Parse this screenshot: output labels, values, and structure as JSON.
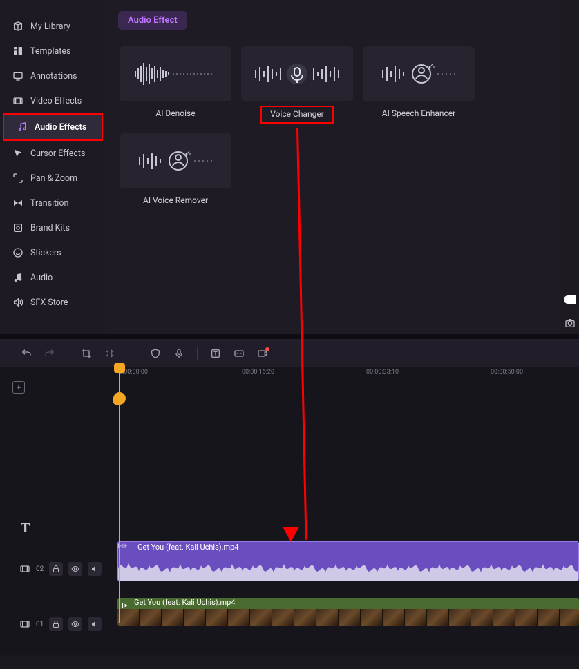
{
  "sidebar": {
    "items": [
      {
        "label": "My Library",
        "icon": "library"
      },
      {
        "label": "Templates",
        "icon": "templates"
      },
      {
        "label": "Annotations",
        "icon": "annotations"
      },
      {
        "label": "Video Effects",
        "icon": "video-fx"
      },
      {
        "label": "Audio Effects",
        "icon": "audio-fx"
      },
      {
        "label": "Cursor Effects",
        "icon": "cursor-fx"
      },
      {
        "label": "Pan & Zoom",
        "icon": "pan-zoom"
      },
      {
        "label": "Transition",
        "icon": "transition"
      },
      {
        "label": "Brand Kits",
        "icon": "brand"
      },
      {
        "label": "Stickers",
        "icon": "stickers"
      },
      {
        "label": "Audio",
        "icon": "audio"
      },
      {
        "label": "SFX Store",
        "icon": "sfx"
      }
    ]
  },
  "header": {
    "title": "Audio Effect"
  },
  "effects": [
    {
      "label": "AI Denoise"
    },
    {
      "label": "Voice Changer"
    },
    {
      "label": "AI Speech Enhancer"
    },
    {
      "label": "AI Voice Remover"
    }
  ],
  "ruler": {
    "ticks": [
      "0:00:00:00",
      "00:00:16:20",
      "00:00:33:10",
      "00:00:50:00"
    ]
  },
  "tracks": {
    "audio": {
      "title": "Get You (feat. Kali Uchis).mp4"
    },
    "video": {
      "title": "Get You (feat. Kali Uchis).mp4"
    },
    "t1_num": "02",
    "t2_num": "01"
  }
}
